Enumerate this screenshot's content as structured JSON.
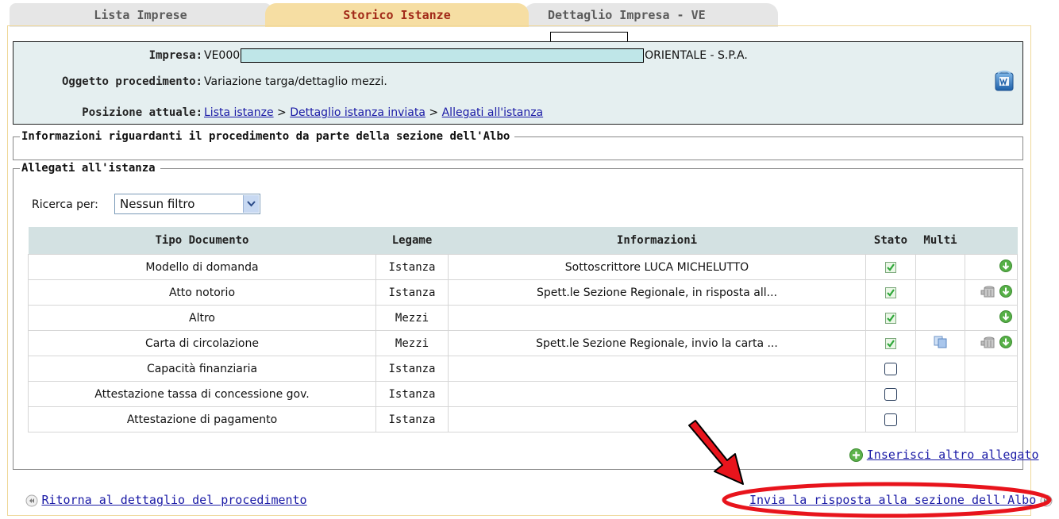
{
  "tabs": [
    {
      "label": "Lista Imprese"
    },
    {
      "label": "Storico Istanze"
    },
    {
      "label": "Dettaglio Impresa - VE"
    }
  ],
  "info": {
    "impresa_label": "Impresa:",
    "impresa_prefix": "VE000",
    "impresa_suffix": "ORIENTALE - S.P.A.",
    "oggetto_label": "Oggetto procedimento:",
    "oggetto_value": "Variazione targa/dettaglio mezzi.",
    "posizione_label": "Posizione attuale:",
    "breadcrumb": {
      "item1": "Lista istanze",
      "sep": " > ",
      "item2": "Dettaglio istanza inviata",
      "item3": "Allegati all'istanza"
    }
  },
  "sections": {
    "informazioni_legend": "Informazioni riguardanti il procedimento da parte della sezione dell'Albo",
    "allegati_legend": "Allegati all'istanza"
  },
  "filter": {
    "label": "Ricerca per:",
    "selected": "Nessun filtro"
  },
  "table": {
    "headers": {
      "tipo": "Tipo Documento",
      "legame": "Legame",
      "informazioni": "Informazioni",
      "stato": "Stato",
      "multi": "Multi"
    },
    "rows": [
      {
        "tipo": "Modello di domanda",
        "legame": "Istanza",
        "informazioni": "Sottoscrittore LUCA MICHELUTTO",
        "stato": "checked"
      },
      {
        "tipo": "Atto notorio",
        "legame": "Istanza",
        "informazioni": "Spett.le Sezione Regionale, in risposta all...",
        "stato": "checked"
      },
      {
        "tipo": "Altro",
        "legame": "Mezzi",
        "informazioni": "",
        "stato": "checked"
      },
      {
        "tipo": "Carta di circolazione",
        "legame": "Mezzi",
        "informazioni": "Spett.le Sezione Regionale, invio la carta ...",
        "stato": "checked"
      },
      {
        "tipo": "Capacità finanziaria",
        "legame": "Istanza",
        "informazioni": "",
        "stato": "unchecked"
      },
      {
        "tipo": "Attestazione tassa di concessione gov.",
        "legame": "Istanza",
        "informazioni": "",
        "stato": "unchecked"
      },
      {
        "tipo": "Attestazione di pagamento",
        "legame": "Istanza",
        "informazioni": "",
        "stato": "unchecked"
      }
    ]
  },
  "actions": {
    "add_attachment": "Inserisci altro allegato",
    "back": "Ritorna al dettaglio del procedimento",
    "send": "Invia la risposta alla sezione dell'Albo"
  },
  "colors": {
    "active_tab_bg": "#f6dea3",
    "active_tab_text": "#a22a18",
    "info_bg": "#e5eff0",
    "link": "#1a1aa6",
    "annotation": "#e8141c"
  },
  "icons": {
    "word_export": "word-icon",
    "download": "download-icon",
    "delete": "trash-icon",
    "multi": "copy-icon",
    "add": "add-icon",
    "back": "rewind-icon",
    "forward": "fast-forward-icon"
  }
}
